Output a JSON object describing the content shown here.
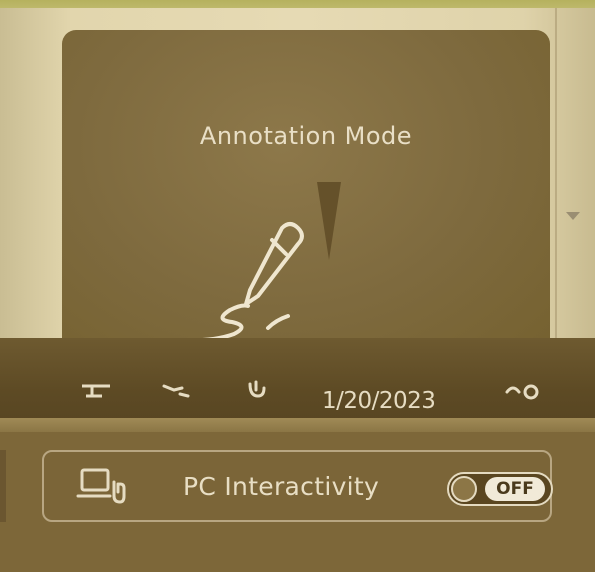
{
  "popup": {
    "title": "Annotation Mode",
    "icon": "pen-icon"
  },
  "toolbar": {
    "date": "1/20/2023",
    "icons": [
      "toolbar-icon-1",
      "toolbar-icon-2",
      "toolbar-icon-3",
      "toolbar-icon-4"
    ]
  },
  "pc_interactivity": {
    "icon": "pc-touch-icon",
    "label": "PC Interactivity",
    "toggle_state": "OFF"
  },
  "colors": {
    "background": "#7c6538",
    "popup": "#7e6a3e",
    "text": "#e9dfc6"
  }
}
